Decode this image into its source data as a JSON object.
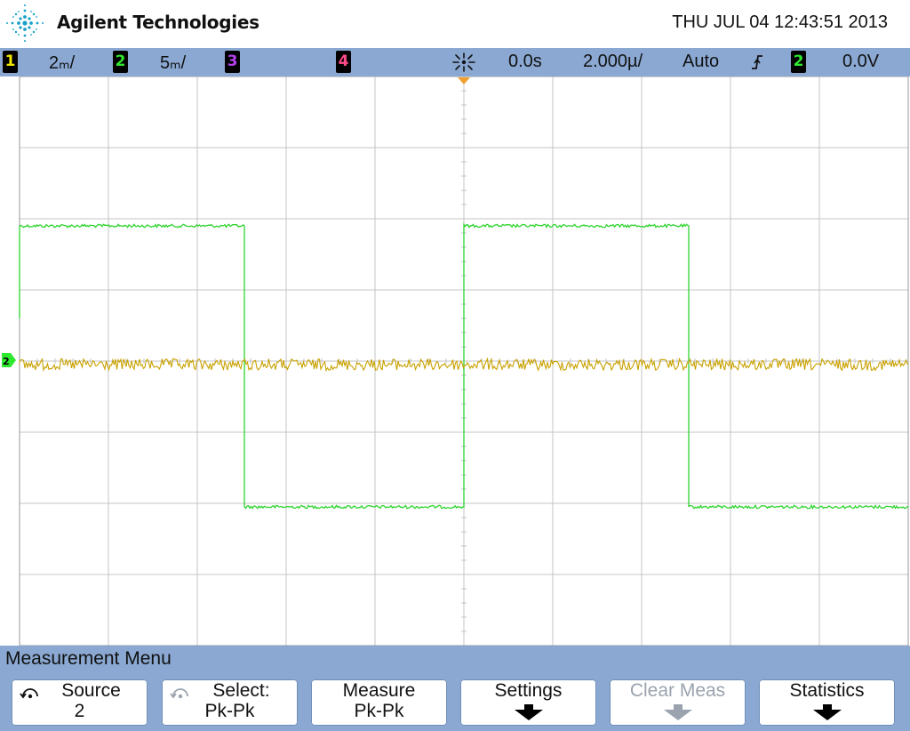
{
  "header": {
    "brand": "Agilent Technologies",
    "datetime": "THU JUL 04 12:43:51 2013"
  },
  "status": {
    "channels": [
      {
        "number": "1",
        "scale": "2ₘ/",
        "color": "#f2e800"
      },
      {
        "number": "2",
        "scale": "5ₘ/",
        "color": "#2ee82e"
      },
      {
        "number": "3",
        "scale": "",
        "color": "#b542f0"
      },
      {
        "number": "4",
        "scale": "",
        "color": "#ff4a8a"
      }
    ],
    "time_delay": "0.0s",
    "time_scale": "2.000µ/",
    "trigger_mode": "Auto",
    "trigger_slope_icon": "rising-edge-icon",
    "trigger_source": "2",
    "trigger_level": "0.0V"
  },
  "ground_marker": "2",
  "chart_data": {
    "type": "line",
    "title": "",
    "grid": true,
    "divisions": {
      "x": 10,
      "y": 8
    },
    "ylim": [
      -4,
      4
    ],
    "xlim": [
      0,
      10
    ],
    "series": [
      {
        "color": "#2fd42f",
        "x": [
          0,
          0,
          2.53,
          2.53,
          5.0,
          5.0,
          7.53,
          7.53,
          10
        ],
        "y": [
          0.6,
          1.9,
          1.9,
          -2.05,
          -2.05,
          1.9,
          1.9,
          -2.05,
          -2.05
        ]
      },
      {
        "color": "#c9a100",
        "x": [
          0,
          10
        ],
        "y": [
          -0.05,
          -0.05
        ]
      }
    ]
  },
  "menu": {
    "title": "Measurement Menu",
    "softkeys": [
      {
        "line1": "Source",
        "line2": "2",
        "enabled": true,
        "icon": "rotate-knob-icon"
      },
      {
        "line1": "Select:",
        "line2": "Pk-Pk",
        "enabled": true,
        "icon": "rotate-knob-icon"
      },
      {
        "line1": "Measure",
        "line2": "Pk-Pk",
        "enabled": true,
        "icon": ""
      },
      {
        "line1": "Settings",
        "line2": "",
        "enabled": true,
        "icon": "down-arrow-icon"
      },
      {
        "line1": "Clear Meas",
        "line2": "",
        "enabled": false,
        "icon": "down-arrow-icon"
      },
      {
        "line1": "Statistics",
        "line2": "",
        "enabled": true,
        "icon": "down-arrow-icon"
      }
    ]
  }
}
